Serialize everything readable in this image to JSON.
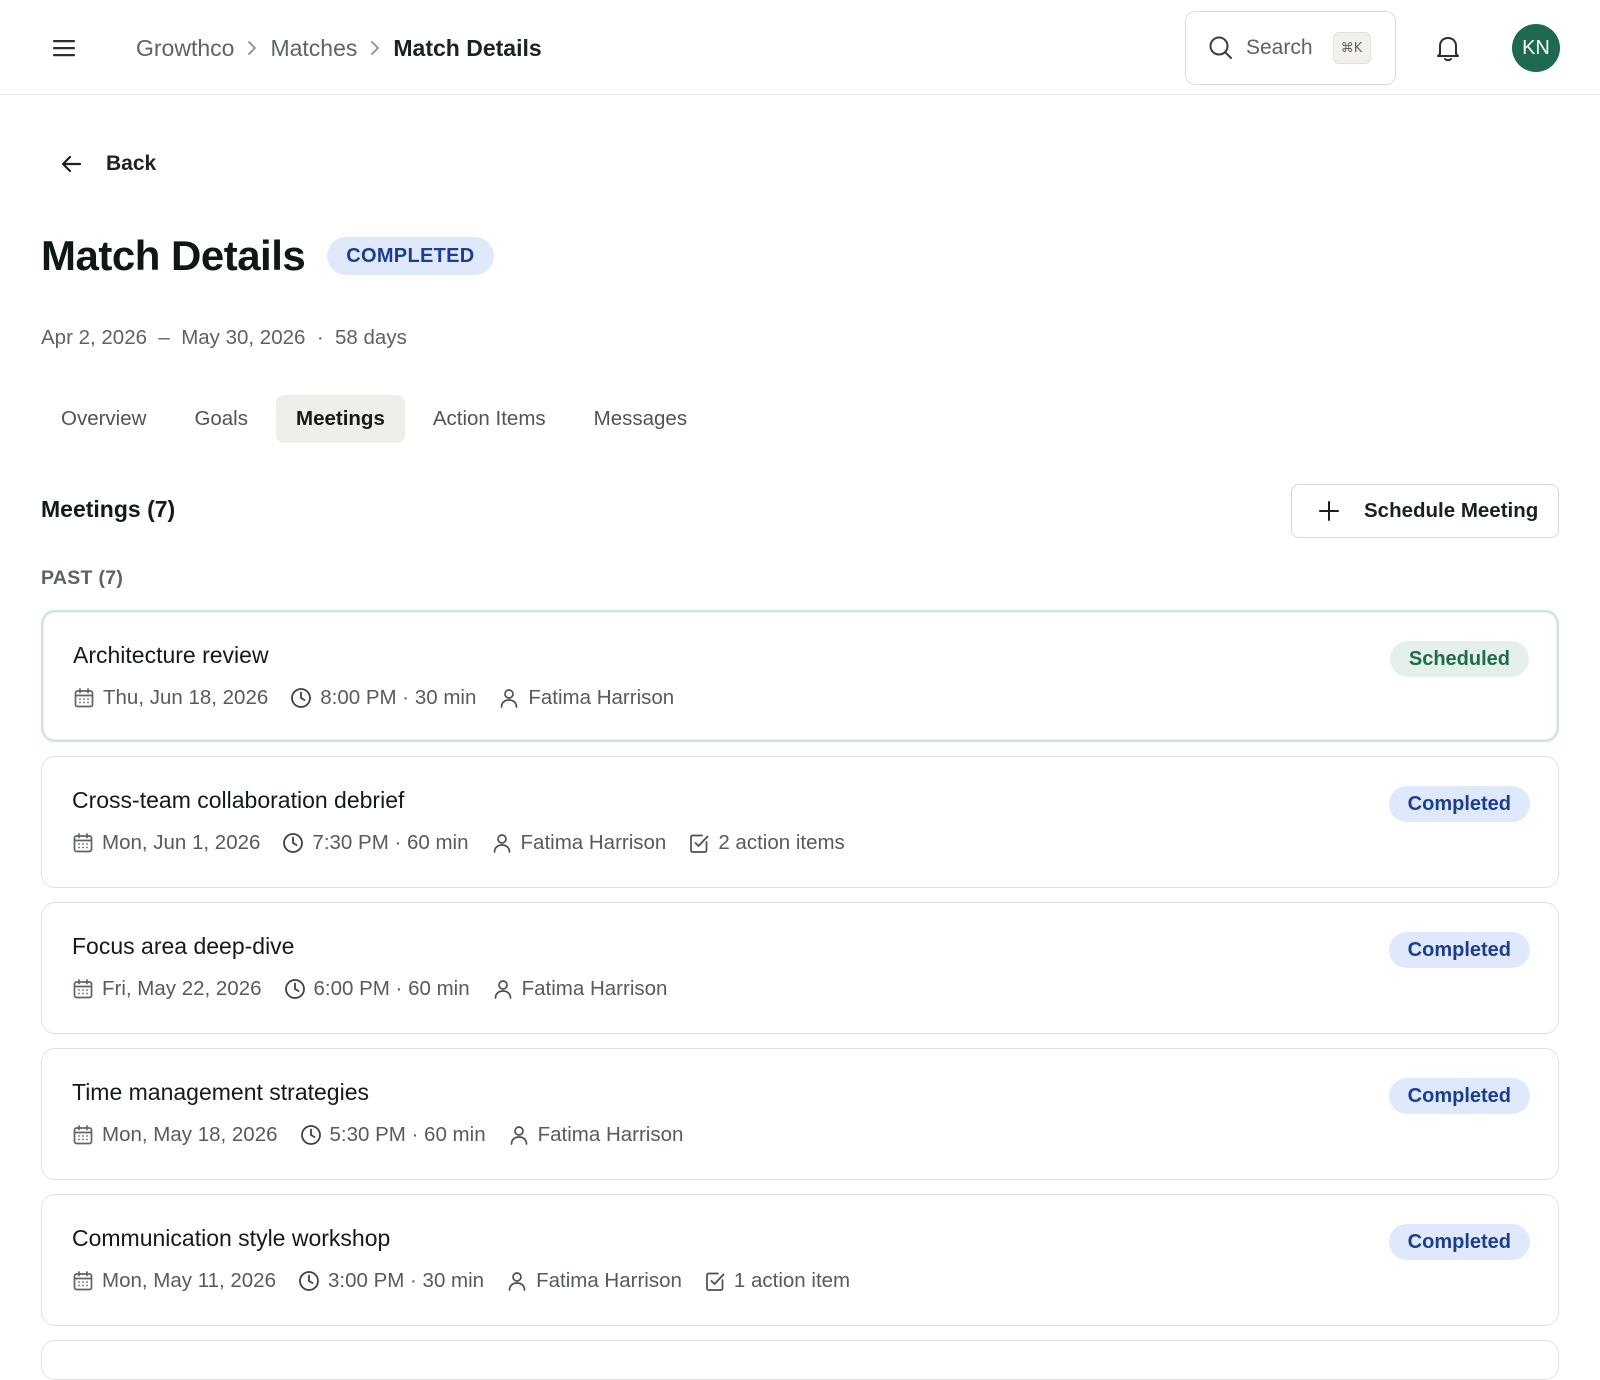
{
  "header": {
    "breadcrumb": [
      "Growthco",
      "Matches",
      "Match Details"
    ],
    "search_label": "Search",
    "search_shortcut": "⌘K",
    "avatar_initials": "KN"
  },
  "page": {
    "back_label": "Back",
    "title": "Match Details",
    "status": "COMPLETED",
    "start_date": "Apr 2, 2026",
    "end_date": "May 30, 2026",
    "duration": "58 days"
  },
  "tabs": [
    {
      "label": "Overview",
      "active": false
    },
    {
      "label": "Goals",
      "active": false
    },
    {
      "label": "Meetings",
      "active": true
    },
    {
      "label": "Action Items",
      "active": false
    },
    {
      "label": "Messages",
      "active": false
    }
  ],
  "meetings": {
    "title": "Meetings (7)",
    "schedule_button": "Schedule Meeting",
    "group_label": "PAST (7)",
    "items": [
      {
        "title": "Architecture review",
        "date": "Thu, Jun 18, 2026",
        "time": "8:00 PM · 30 min",
        "person": "Fatima Harrison",
        "action_items": "",
        "status": "Scheduled"
      },
      {
        "title": "Cross-team collaboration debrief",
        "date": "Mon, Jun 1, 2026",
        "time": "7:30 PM · 60 min",
        "person": "Fatima Harrison",
        "action_items": "2 action items",
        "status": "Completed"
      },
      {
        "title": "Focus area deep-dive",
        "date": "Fri, May 22, 2026",
        "time": "6:00 PM · 60 min",
        "person": "Fatima Harrison",
        "action_items": "",
        "status": "Completed"
      },
      {
        "title": "Time management strategies",
        "date": "Mon, May 18, 2026",
        "time": "5:30 PM · 60 min",
        "person": "Fatima Harrison",
        "action_items": "",
        "status": "Completed"
      },
      {
        "title": "Communication style workshop",
        "date": "Mon, May 11, 2026",
        "time": "3:00 PM · 30 min",
        "person": "Fatima Harrison",
        "action_items": "1 action item",
        "status": "Completed"
      }
    ]
  },
  "colors": {
    "accent_green": "#1d6a4f",
    "completed_bg": "#dfe9fb",
    "completed_text": "#1b3f8e",
    "scheduled_bg": "#e5f0ea",
    "scheduled_text": "#1f6b4b"
  }
}
